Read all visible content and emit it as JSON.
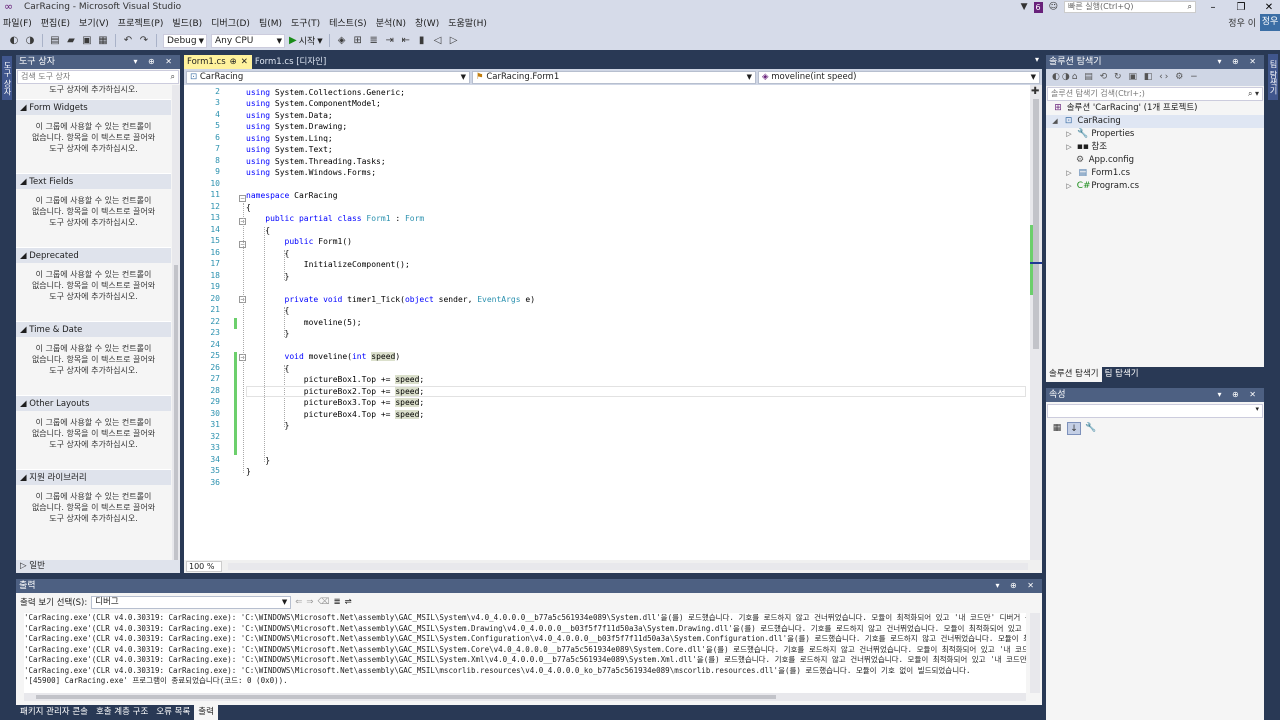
{
  "window": {
    "title": "CarRacing - Microsoft Visual Studio",
    "notification_count": "6",
    "quick_launch_placeholder": "빠른 실행(Ctrl+Q)",
    "user": "정우 이",
    "user_initial": "정우"
  },
  "menu": [
    "파일(F)",
    "편집(E)",
    "보기(V)",
    "프로젝트(P)",
    "빌드(B)",
    "디버그(D)",
    "팀(M)",
    "도구(T)",
    "테스트(S)",
    "분석(N)",
    "창(W)",
    "도움말(H)"
  ],
  "toolbar": {
    "config": "Debug",
    "platform": "Any CPU",
    "start_label": "시작"
  },
  "left_strip": {
    "tab": "도구 상자"
  },
  "right_strip": {
    "tab": "팀 탐색기"
  },
  "toolbox": {
    "title": "도구 상자",
    "search_placeholder": "검색 도구 상자",
    "first_line": "도구 상자에 추가하십시오.",
    "empty_message_1": "이 그룹에 사용할 수 있는 컨트롤이",
    "empty_message_2": "없습니다. 항목을 이 텍스트로 끌어와",
    "empty_message_3": "도구 상자에 추가하십시오.",
    "groups": [
      "Form Widgets",
      "Text Fields",
      "Deprecated",
      "Time & Date",
      "Other Layouts",
      "지원 라이브러리"
    ],
    "general": "일반"
  },
  "editor": {
    "tabs": [
      {
        "label": "Form1.cs",
        "pin": "⊕",
        "close": "✕"
      },
      {
        "label": "Form1.cs [디자인]"
      }
    ],
    "nav_project": "CarRacing",
    "nav_class": "CarRacing.Form1",
    "nav_member": "moveline(int speed)",
    "zoom": "100 %",
    "line_numbers": [
      "2",
      "3",
      "4",
      "5",
      "6",
      "7",
      "8",
      "9",
      "10",
      "11",
      "12",
      "13",
      "14",
      "15",
      "16",
      "17",
      "18",
      "19",
      "20",
      "21",
      "22",
      "23",
      "24",
      "25",
      "26",
      "27",
      "28",
      "29",
      "30",
      "31",
      "32",
      "33",
      "34",
      "35",
      "36"
    ]
  },
  "solution_explorer": {
    "title": "솔루션 탐색기",
    "search_placeholder": "솔루션 탐색기 검색(Ctrl+;)",
    "solution": "솔루션 'CarRacing' (1개 프로젝트)",
    "project": "CarRacing",
    "items": [
      "Properties",
      "참조",
      "App.config",
      "Form1.cs",
      "Program.cs"
    ],
    "tab_solution": "솔루션 탐색기",
    "tab_team": "팀 탐색기"
  },
  "properties": {
    "title": "속성"
  },
  "output": {
    "title": "출력",
    "show_from_label": "출력 보기 선택(S):",
    "show_from_value": "디버그",
    "lines": [
      "'CarRacing.exe'(CLR v4.0.30319: CarRacing.exe): 'C:\\WINDOWS\\Microsoft.Net\\assembly\\GAC_MSIL\\System\\v4.0_4.0.0.0__b77a5c561934e089\\System.dll'을(를) 로드했습니다. 기호를 로드하지 않고 건너뛰었습니다. 모듈이 최적화되어 있고 '내 코드만' 디버거 옵션",
      "'CarRacing.exe'(CLR v4.0.30319: CarRacing.exe): 'C:\\WINDOWS\\Microsoft.Net\\assembly\\GAC_MSIL\\System.Drawing\\v4.0_4.0.0.0__b03f5f7f11d50a3a\\System.Drawing.dll'을(를) 로드했습니다. 기호를 로드하지 않고 건너뛰었습니다. 모듈이 최적화되어 있고 '내 코드만'",
      "'CarRacing.exe'(CLR v4.0.30319: CarRacing.exe): 'C:\\WINDOWS\\Microsoft.Net\\assembly\\GAC_MSIL\\System.Configuration\\v4.0_4.0.0.0__b03f5f7f11d50a3a\\System.Configuration.dll'을(를) 로드했습니다. 기호를 로드하지 않고 건너뛰었습니다. 모듈이 최적화되어 있고",
      "'CarRacing.exe'(CLR v4.0.30319: CarRacing.exe): 'C:\\WINDOWS\\Microsoft.Net\\assembly\\GAC_MSIL\\System.Core\\v4.0_4.0.0.0__b77a5c561934e089\\System.Core.dll'을(를) 로드했습니다. 기호를 로드하지 않고 건너뛰었습니다. 모듈이 최적화되어 있고 '내 코드만' 디버거",
      "'CarRacing.exe'(CLR v4.0.30319: CarRacing.exe): 'C:\\WINDOWS\\Microsoft.Net\\assembly\\GAC_MSIL\\System.Xml\\v4.0_4.0.0.0__b77a5c561934e089\\System.Xml.dll'을(를) 로드했습니다. 기호를 로드하지 않고 건너뛰었습니다. 모듈이 최적화되어 있고 '내 코드만' 디버거 옵",
      "'CarRacing.exe'(CLR v4.0.30319: CarRacing.exe): 'C:\\WINDOWS\\Microsoft.Net\\assembly\\GAC_MSIL\\mscorlib.resources\\v4.0_4.0.0.0_ko_b77a5c561934e089\\mscorlib.resources.dll'을(를) 로드했습니다. 모듈이 기호 없이 빌드되었습니다.",
      "'[45900] CarRacing.exe' 프로그램이 종료되었습니다(코드: 0 (0x0))."
    ]
  },
  "bottom_tabs": [
    "패키지 관리자 콘솔",
    "호출 계층 구조",
    "오류 목록",
    "출력"
  ]
}
